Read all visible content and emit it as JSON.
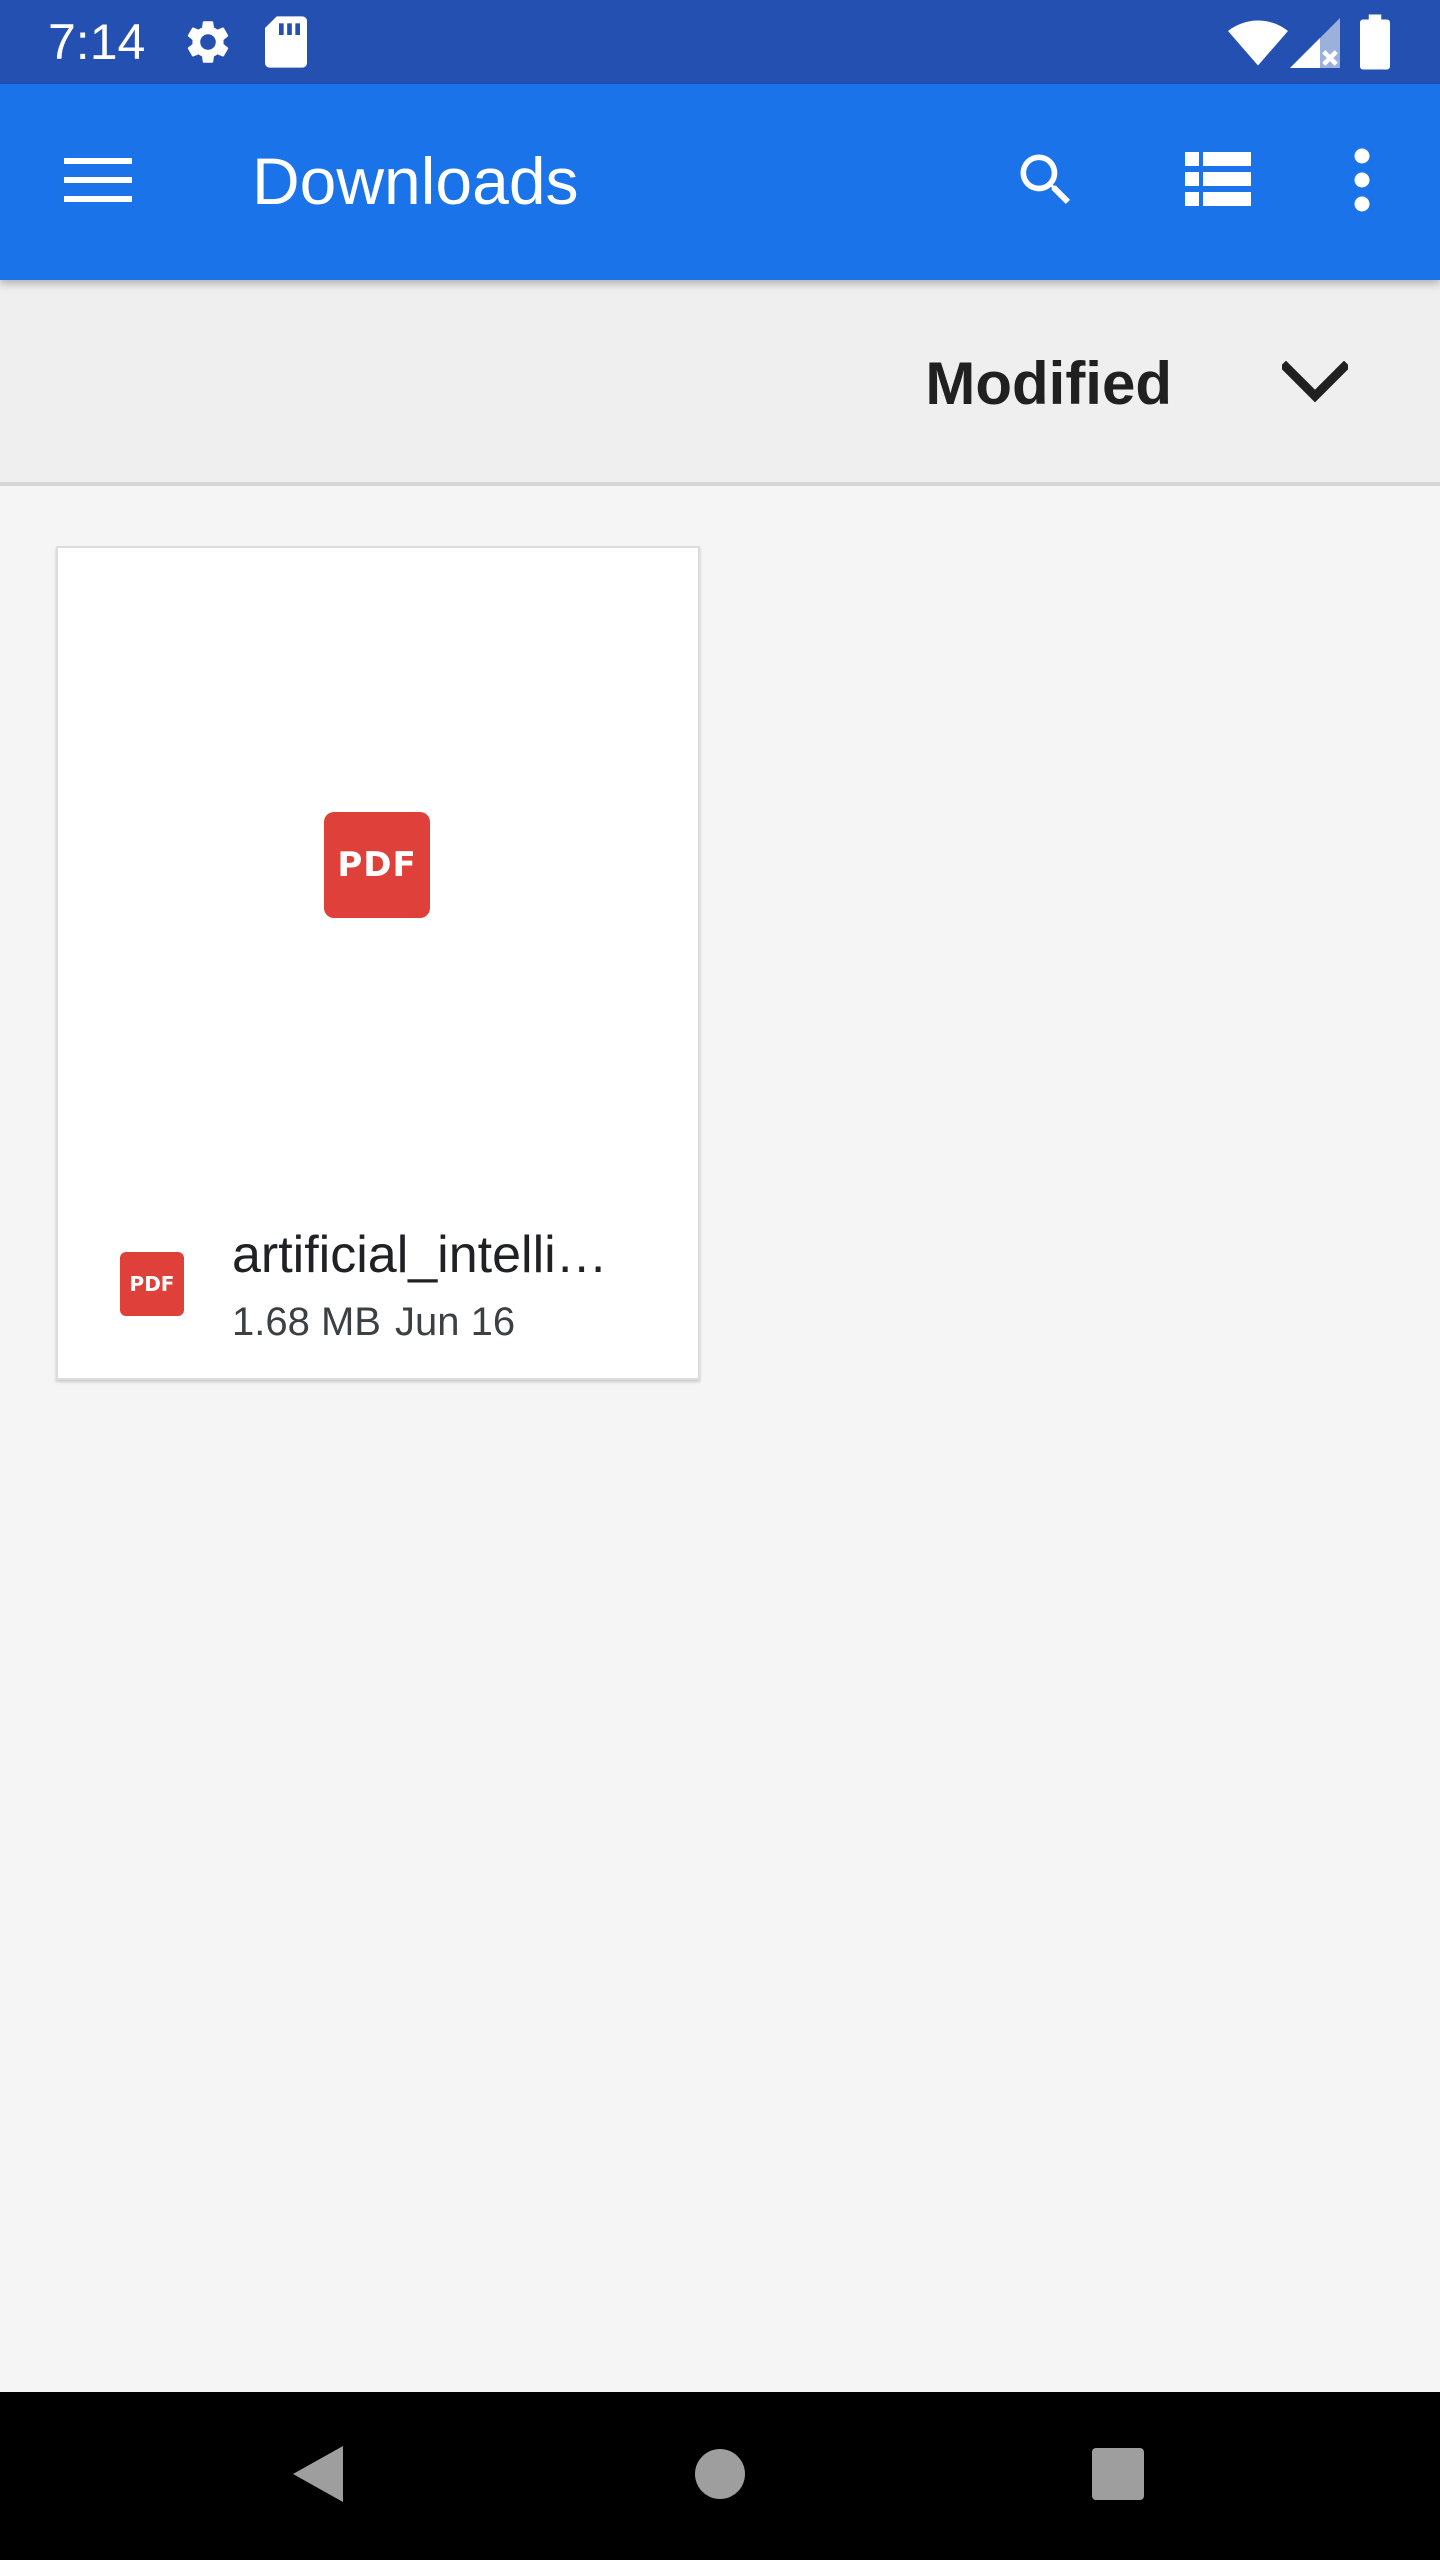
{
  "status_bar": {
    "time": "7:14",
    "icons": [
      "settings-icon",
      "sd-card-icon",
      "wifi-icon",
      "cell-signal-no-data-icon",
      "battery-icon"
    ]
  },
  "app_bar": {
    "title": "Downloads",
    "color": "#1a73e8",
    "icons": [
      "menu-icon",
      "search-icon",
      "list-view-icon",
      "more-vert-icon"
    ]
  },
  "sort_bar": {
    "label": "Modified",
    "icon": "chevron-down-icon"
  },
  "files": [
    {
      "name": "artificial_intelli…",
      "size": "1.68 MB",
      "date": "Jun 16",
      "type_badge": "PDF",
      "icon": "pdf-icon",
      "badge_color": "#e0403a"
    }
  ],
  "nav_bar": {
    "icons": [
      "back-icon",
      "home-icon",
      "recents-icon"
    ]
  }
}
